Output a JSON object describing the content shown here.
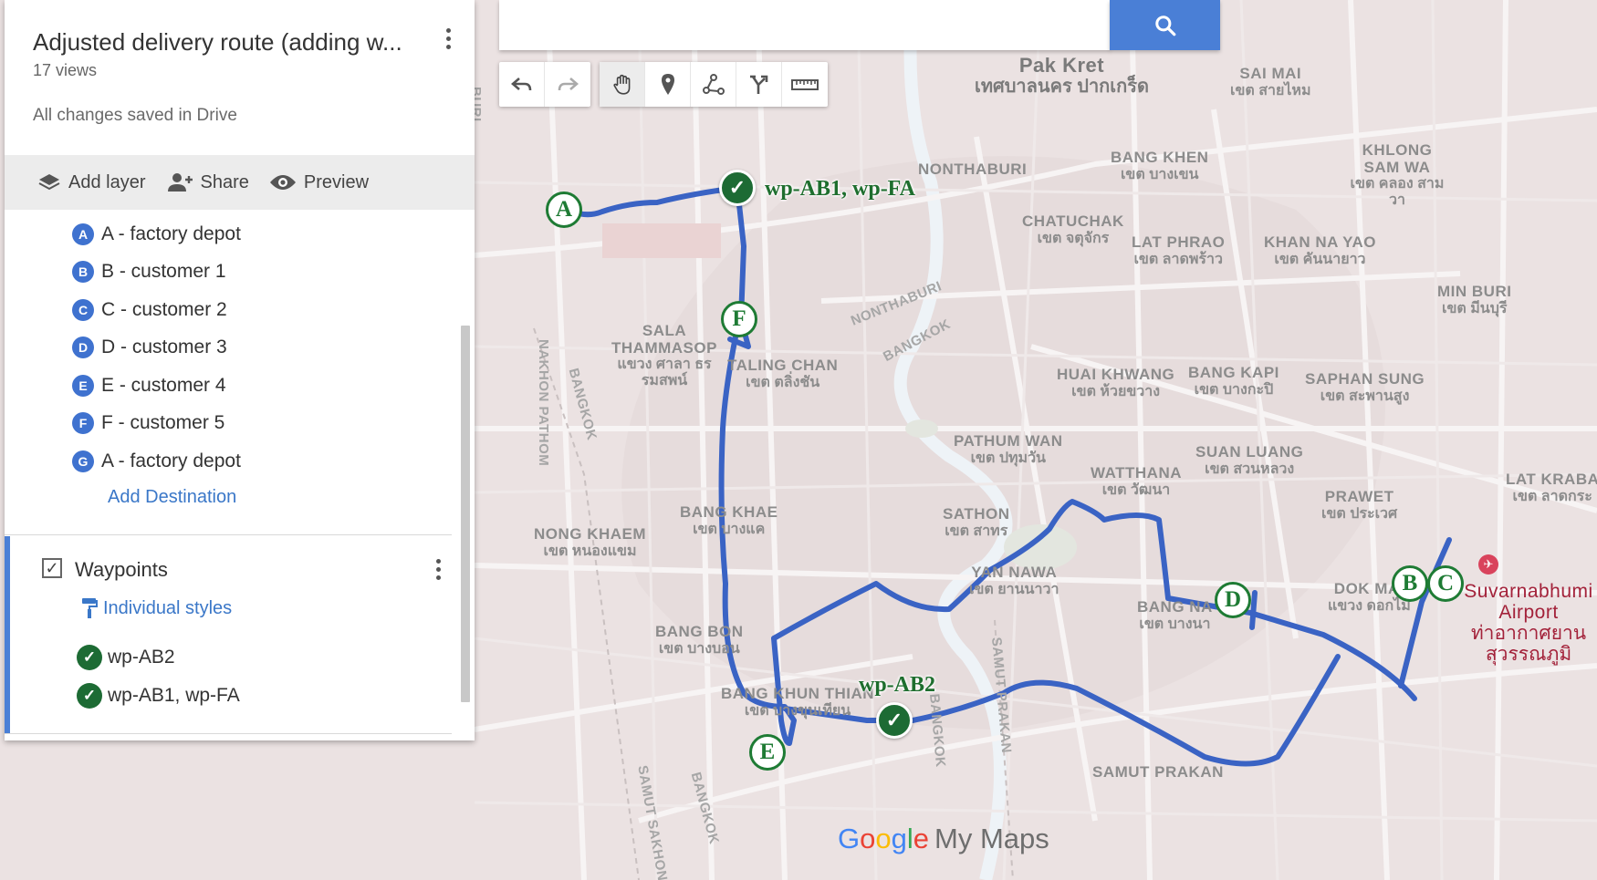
{
  "sidebar": {
    "title": "Adjusted delivery route (adding w...",
    "views": "17 views",
    "saved_status": "All changes saved in Drive",
    "actions": {
      "add_layer": "Add layer",
      "share": "Share",
      "preview": "Preview"
    },
    "destinations": [
      {
        "badge": "A",
        "label": "A - factory depot"
      },
      {
        "badge": "B",
        "label": "B - customer 1"
      },
      {
        "badge": "C",
        "label": "C - customer 2"
      },
      {
        "badge": "D",
        "label": "D - customer 3"
      },
      {
        "badge": "E",
        "label": "E - customer 4"
      },
      {
        "badge": "F",
        "label": "F - customer 5"
      },
      {
        "badge": "G",
        "label": "A - factory depot"
      }
    ],
    "add_destination": "Add Destination",
    "layer": {
      "title": "Waypoints",
      "checked": true,
      "style_link": "Individual styles",
      "items": [
        "wp-AB2",
        "wp-AB1, wp-FA"
      ]
    }
  },
  "search": {
    "placeholder": "",
    "button_icon": "search-icon"
  },
  "toolbar": {
    "tools": [
      "undo-icon",
      "redo-icon",
      "hand-icon",
      "marker-icon",
      "draw-line-icon",
      "directions-icon",
      "ruler-icon"
    ],
    "active_tool": "hand-icon"
  },
  "map": {
    "district_labels": [
      {
        "en": "Pak Kret",
        "th": "เทศบาลนคร ปากเกร็ด",
        "style": "big"
      },
      {
        "en": "SAI MAI",
        "th": "เขต สายไหม"
      },
      {
        "en": "NONTHABURI",
        "th": ""
      },
      {
        "en": "BANG KHEN",
        "th": "เขต บางเขน"
      },
      {
        "en": "KHLONG SAM WA",
        "th": "เขต คลอง สามวา"
      },
      {
        "en": "CHATUCHAK",
        "th": "เขต จตุจักร"
      },
      {
        "en": "LAT PHRAO",
        "th": "เขต ลาดพร้าว"
      },
      {
        "en": "KHAN NA YAO",
        "th": "เขต คันนายาว"
      },
      {
        "en": "MIN BURI",
        "th": "เขต มีนบุรี"
      },
      {
        "en": "SALA THAMMASOP",
        "th": "แขวง ศาลา ธรรมสพน์"
      },
      {
        "en": "TALING CHAN",
        "th": "เขต ตลิ่งชัน"
      },
      {
        "en": "HUAI KHWANG",
        "th": "เขต ห้วยขวาง"
      },
      {
        "en": "BANG KAPI",
        "th": "เขต บางกะปิ"
      },
      {
        "en": "SAPHAN SUNG",
        "th": "เขต สะพานสูง"
      },
      {
        "en": "PATHUM WAN",
        "th": "เขต ปทุมวัน"
      },
      {
        "en": "SUAN LUANG",
        "th": "เขต สวนหลวง"
      },
      {
        "en": "WATTHANA",
        "th": "เขต วัฒนา"
      },
      {
        "en": "LAT KRABA",
        "th": "เขต ลาดกระ"
      },
      {
        "en": "PRAWET",
        "th": "เขต ประเวศ"
      },
      {
        "en": "BANG KHAE",
        "th": "เขต บางแค"
      },
      {
        "en": "SATHON",
        "th": "เขต สาทร"
      },
      {
        "en": "NONG KHAEM",
        "th": "เขต หนองแขม"
      },
      {
        "en": "YAN NAWA",
        "th": "เขต ยานนาวา"
      },
      {
        "en": "DOK MAI",
        "th": "แขวง ดอกไม้"
      },
      {
        "en": "BANG BON",
        "th": "เขต บางบอน"
      },
      {
        "en": "BANG NA",
        "th": "เขต บางนา"
      },
      {
        "en": "BANG KHUN THIAN",
        "th": "เขต บางขุนเทียน"
      },
      {
        "en": "SAMUT PRAKAN",
        "th": ""
      },
      {
        "en": "Suvarnabhumi Airport",
        "th": "ท่าอากาศยาน สุวรรณภูมิ",
        "style": "red"
      }
    ],
    "road_labels": [
      "BURI",
      "NONTHABURI",
      "BANGKOK",
      "NAKHON PATHOM",
      "BANGKOK",
      "SAMUT PRAKAN",
      "BANGKOK",
      "SAMUT SAKHON",
      "BANGKOK"
    ],
    "markers": [
      {
        "letter": "A"
      },
      {
        "letter": "F"
      },
      {
        "letter": "D"
      },
      {
        "letter": "B"
      },
      {
        "letter": "C"
      },
      {
        "letter": "E"
      }
    ],
    "waypoints": [
      {
        "label": "wp-AB1, wp-FA"
      },
      {
        "label": "wp-AB2"
      }
    ],
    "route_color": "#3a63c4",
    "logo": {
      "google": "Google",
      "product": "My Maps"
    }
  }
}
